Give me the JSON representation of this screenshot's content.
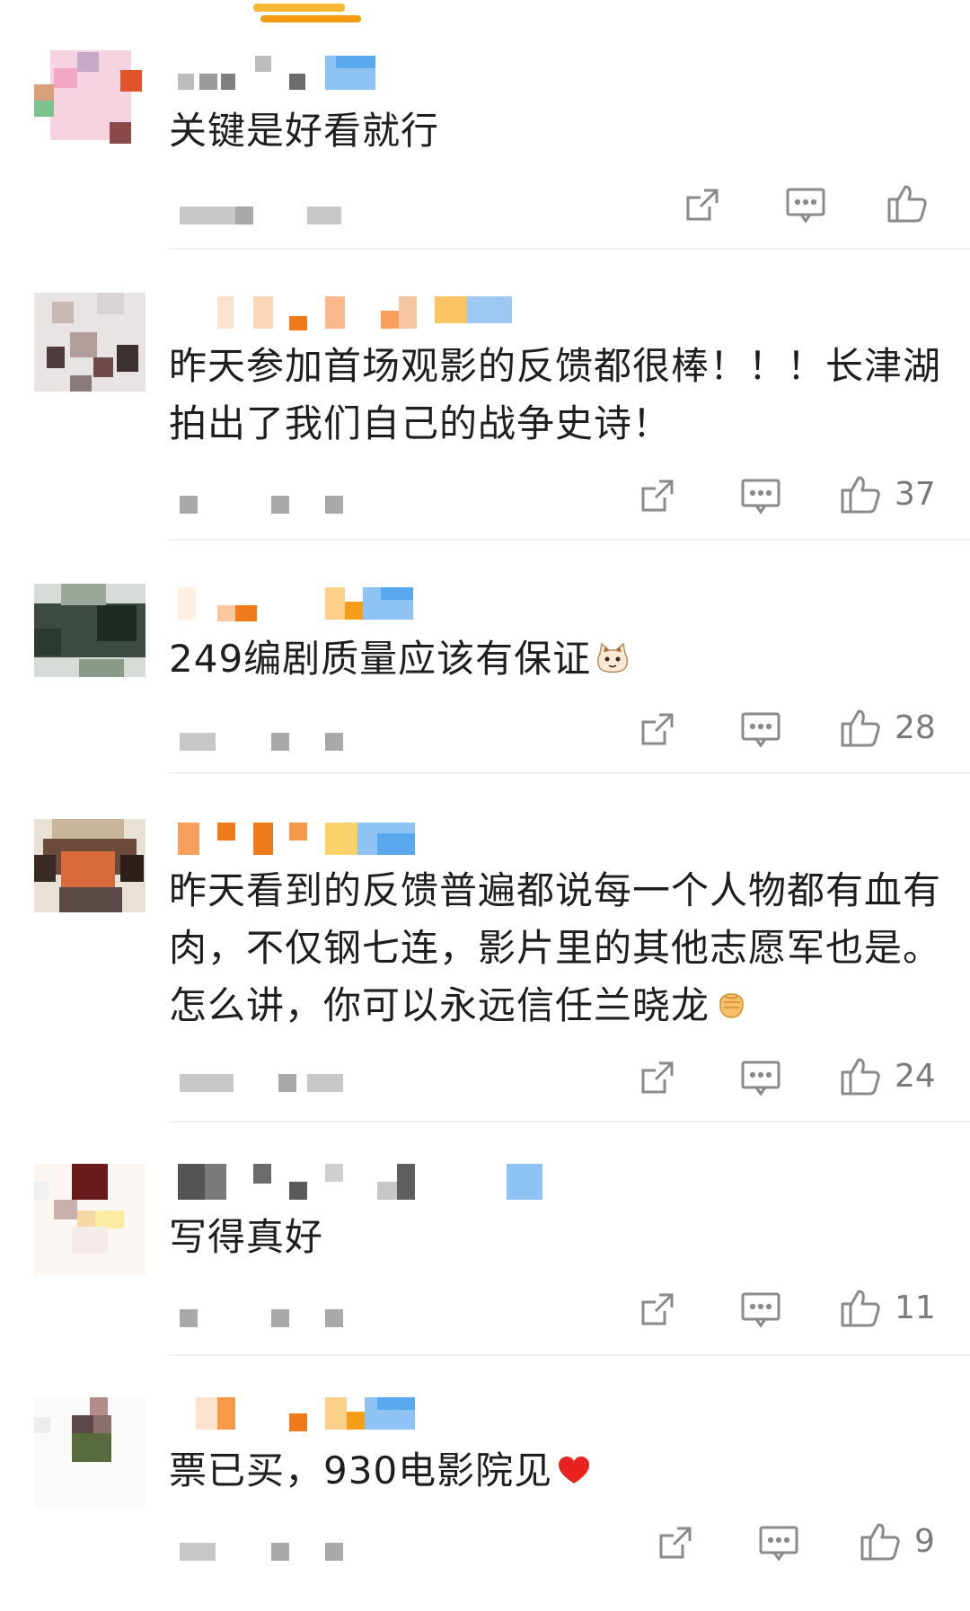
{
  "comments": [
    {
      "text": "关键是好看就行",
      "like_count": ""
    },
    {
      "text": "昨天参加首场观影的反馈都很棒！！！长津湖拍出了我们自己的战争史诗！",
      "like_count": "37"
    },
    {
      "text": "249编剧质量应该有保证",
      "emoji": "cat-emoji",
      "like_count": "28"
    },
    {
      "text": "昨天看到的反馈普遍都说每一个人物都有血有肉，不仅钢七连，影片里的其他志愿军也是。怎么讲，你可以永远信任兰晓龙",
      "emoji": "fist-emoji",
      "like_count": "24"
    },
    {
      "text": "写得真好",
      "like_count": "11"
    },
    {
      "text": "票已买，930电影院见",
      "emoji": "heart-emoji",
      "like_count": "9"
    }
  ],
  "icons": {
    "share": "share-icon",
    "reply": "comment-icon",
    "like": "thumbs-up-icon"
  },
  "colors": {
    "text": "#1e1e1e",
    "icon": "#8a8a8a",
    "like_count": "#7a7a7a",
    "accent_orange": "#f39c12",
    "accent_blue": "#6fb3f0"
  }
}
